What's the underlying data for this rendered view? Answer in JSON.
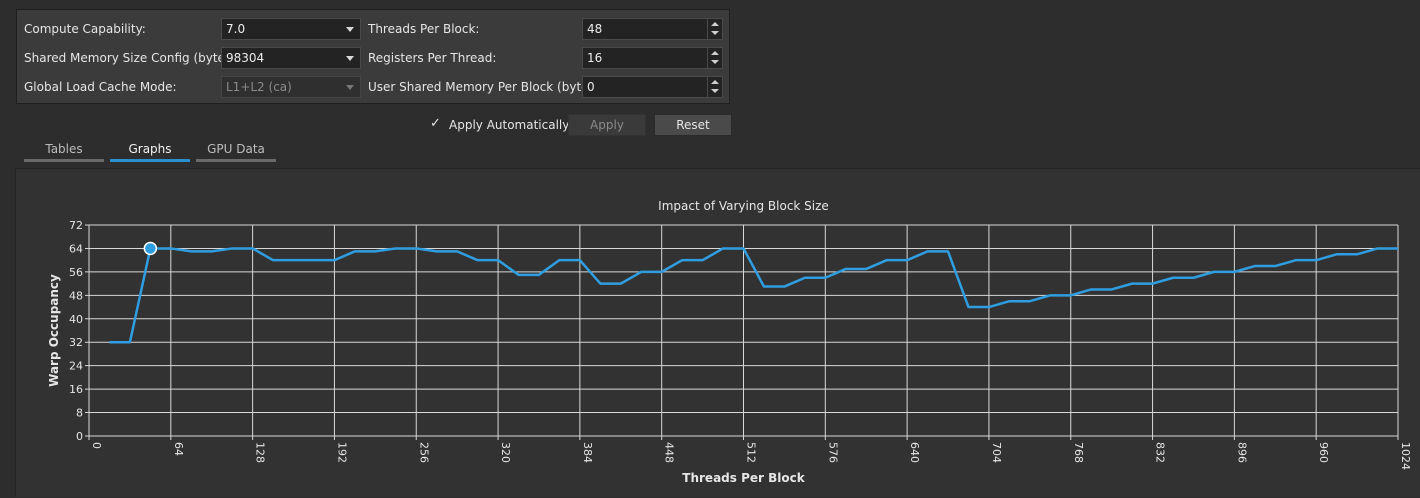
{
  "config": {
    "compute_capability_label": "Compute Capability:",
    "compute_capability_value": "7.0",
    "shared_mem_label": "Shared Memory Size Config (bytes):",
    "shared_mem_value": "98304",
    "cache_mode_label": "Global Load Cache Mode:",
    "cache_mode_value": "L1+L2 (ca)",
    "threads_label": "Threads Per Block:",
    "threads_value": "48",
    "registers_label": "Registers Per Thread:",
    "registers_value": "16",
    "user_shared_label": "User Shared Memory Per Block (bytes):",
    "user_shared_value": "0"
  },
  "actions": {
    "apply_auto_label": "Apply Automatically",
    "apply_auto_checked": true,
    "apply_label": "Apply",
    "reset_label": "Reset"
  },
  "tabs": [
    {
      "label": "Tables",
      "active": false
    },
    {
      "label": "Graphs",
      "active": true
    },
    {
      "label": "GPU Data",
      "active": false
    }
  ],
  "colors": {
    "accent": "#2b8fd0",
    "line": "#2f9ee0"
  },
  "chart_data": {
    "type": "line",
    "title": "Impact of Varying Block Size",
    "xlabel": "Threads Per Block",
    "ylabel": "Warp Occupancy",
    "xlim": [
      0,
      1024
    ],
    "ylim": [
      0,
      72
    ],
    "xticks": [
      0,
      64,
      128,
      192,
      256,
      320,
      384,
      448,
      512,
      576,
      640,
      704,
      768,
      832,
      896,
      960,
      1024
    ],
    "yticks": [
      0,
      8,
      16,
      24,
      32,
      40,
      48,
      56,
      64,
      72
    ],
    "grid": true,
    "highlight": {
      "x": 48,
      "y": 64
    },
    "series": [
      {
        "x": [
          16,
          32,
          48,
          64,
          80,
          96,
          112,
          128,
          144,
          160,
          176,
          192,
          208,
          224,
          240,
          256,
          272,
          288,
          304,
          320,
          336,
          352,
          368,
          384,
          400,
          416,
          432,
          448,
          464,
          480,
          496,
          512,
          528,
          544,
          560,
          576,
          592,
          608,
          624,
          640,
          656,
          672,
          688,
          704,
          720,
          736,
          752,
          768,
          784,
          800,
          816,
          832,
          848,
          864,
          880,
          896,
          912,
          928,
          944,
          960,
          976,
          992,
          1008,
          1024
        ],
        "values": [
          32,
          32,
          64,
          64,
          63,
          63,
          64,
          64,
          60,
          60,
          60,
          60,
          63,
          63,
          64,
          64,
          63,
          63,
          60,
          60,
          55,
          55,
          60,
          60,
          52,
          52,
          56,
          56,
          60,
          60,
          64,
          64,
          51,
          51,
          54,
          54,
          57,
          57,
          60,
          60,
          63,
          63,
          44,
          44,
          46,
          46,
          48,
          48,
          50,
          50,
          52,
          52,
          54,
          54,
          56,
          56,
          58,
          58,
          60,
          60,
          62,
          62,
          64,
          64
        ]
      }
    ]
  }
}
